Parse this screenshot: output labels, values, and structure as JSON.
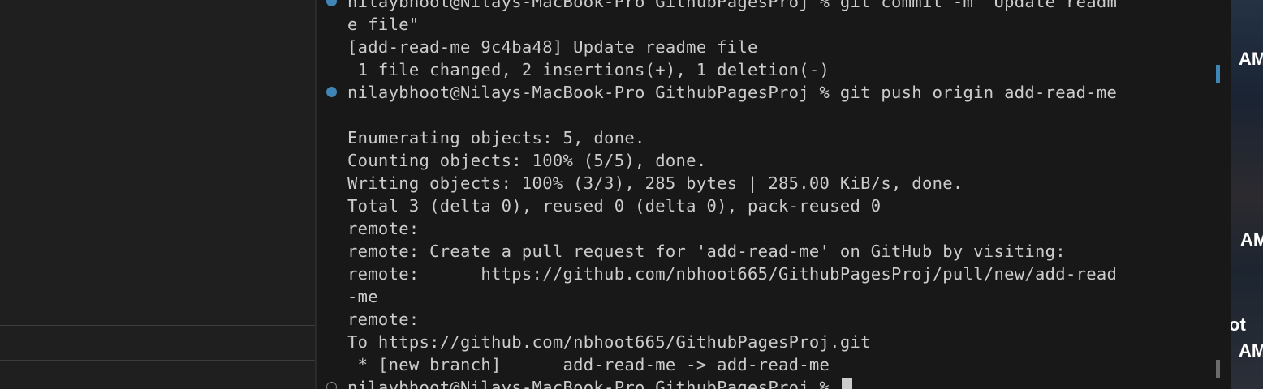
{
  "terminal": {
    "lines": [
      {
        "text": "nilaybhoot@Nilays-MacBook-Pro GithubPagesProj % git commit -m \"Update readm",
        "deco": "success"
      },
      {
        "text": "e file\"",
        "deco": ""
      },
      {
        "text": "[add-read-me 9c4ba48] Update readme file",
        "deco": ""
      },
      {
        "text": " 1 file changed, 2 insertions(+), 1 deletion(-)",
        "deco": ""
      },
      {
        "text": "nilaybhoot@Nilays-MacBook-Pro GithubPagesProj % git push origin add-read-me",
        "deco": "success"
      },
      {
        "text": "",
        "deco": ""
      },
      {
        "text": "Enumerating objects: 5, done.",
        "deco": ""
      },
      {
        "text": "Counting objects: 100% (5/5), done.",
        "deco": ""
      },
      {
        "text": "Writing objects: 100% (3/3), 285 bytes | 285.00 KiB/s, done.",
        "deco": ""
      },
      {
        "text": "Total 3 (delta 0), reused 0 (delta 0), pack-reused 0",
        "deco": ""
      },
      {
        "text": "remote:",
        "deco": ""
      },
      {
        "text": "remote: Create a pull request for 'add-read-me' on GitHub by visiting:",
        "deco": ""
      },
      {
        "text": "remote:      https://github.com/nbhoot665/GithubPagesProj/pull/new/add-read",
        "deco": ""
      },
      {
        "text": "-me",
        "deco": ""
      },
      {
        "text": "remote:",
        "deco": ""
      },
      {
        "text": "To https://github.com/nbhoot665/GithubPagesProj.git",
        "deco": ""
      },
      {
        "text": " * [new branch]      add-read-me -> add-read-me",
        "deco": ""
      },
      {
        "text": "nilaybhoot@Nilays-MacBook-Pro GithubPagesProj % ",
        "deco": "empty",
        "cursor": true
      }
    ]
  },
  "desktop": {
    "texts": [
      "AM",
      "AM",
      "ot",
      "AM"
    ]
  },
  "colors": {
    "terminal_bg": "#181818",
    "terminal_fg": "#cccccc",
    "success_decoration": "#3f86b6",
    "sidebar_bg": "#1f1f1f"
  }
}
